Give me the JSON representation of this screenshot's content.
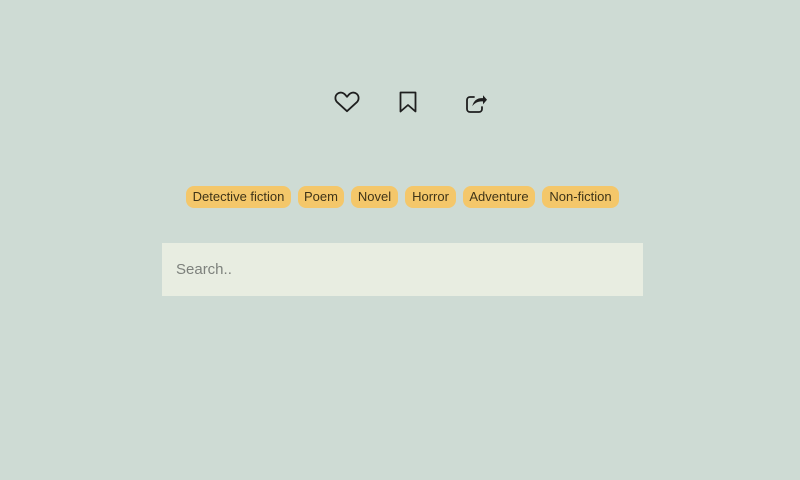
{
  "actions": {
    "like_icon": "heart-icon",
    "bookmark_icon": "bookmark-icon",
    "share_icon": "share-icon"
  },
  "tags": [
    "Detective fiction",
    "Poem",
    "Novel",
    "Horror",
    "Adventure",
    "Non-fiction"
  ],
  "search": {
    "placeholder": "Search..",
    "value": ""
  },
  "colors": {
    "page_background": "#cedbd4",
    "tag_background": "#f4c76a",
    "search_background": "#e8ede1",
    "icon_stroke": "#1f1f1f"
  }
}
